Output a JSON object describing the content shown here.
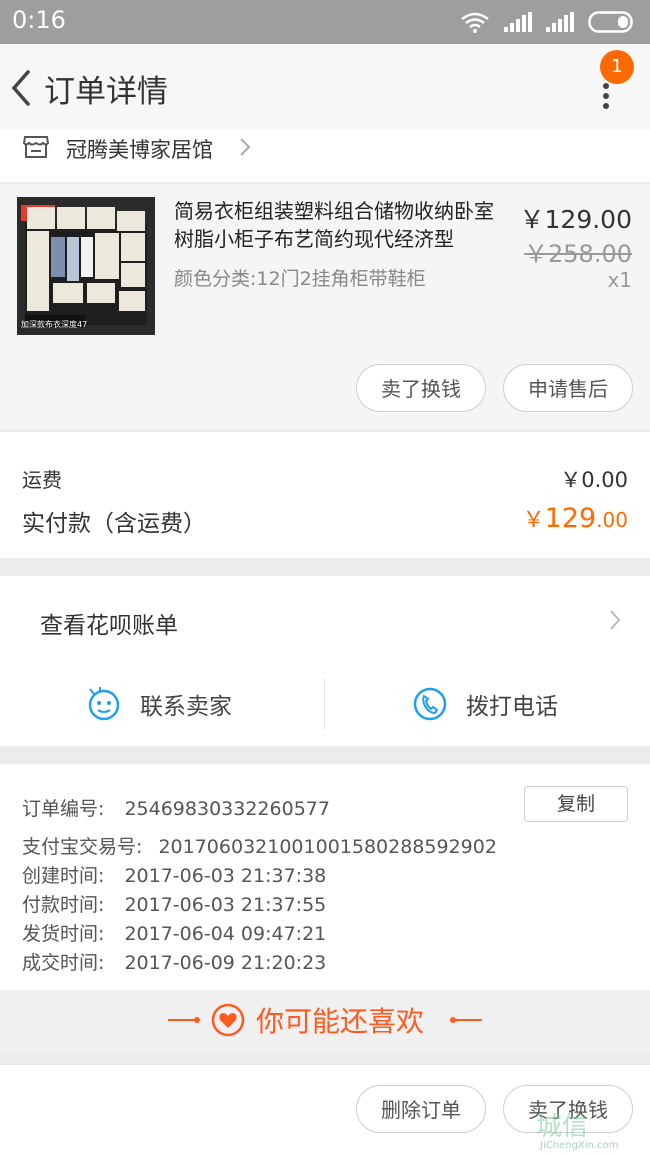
{
  "status_bar": {
    "time": "0:16"
  },
  "nav": {
    "title": "订单详情",
    "badge": "1"
  },
  "store": {
    "name": "冠腾美博家居馆"
  },
  "product": {
    "title": "简易衣柜组装塑料组合储物收纳卧室树脂小柜子布艺简约现代经济型",
    "spec": "颜色分类:12门2挂角柜带鞋柜",
    "price": "￥129.00",
    "original_price": "￥258.00",
    "quantity": "x1",
    "thumb_label": "冠腾",
    "thumb_caption": "加深款布衣深度47",
    "buttons": {
      "sell": "卖了换钱",
      "after_sale": "申请售后"
    }
  },
  "fees": {
    "shipping_label": "运费",
    "shipping_value": "￥0.00",
    "paid_label": "实付款（含运费）",
    "paid_currency": "￥",
    "paid_main": "129",
    "paid_cents": ".00"
  },
  "help": {
    "huabei_label": "查看花呗账单",
    "contact_seller": "联系卖家",
    "call_phone": "拨打电话"
  },
  "order_info": {
    "copy_label": "复制",
    "rows": [
      {
        "label": "订单编号:",
        "value": "25469830332260577"
      },
      {
        "label": "支付宝交易号:",
        "value": "2017060321001001580288592902"
      },
      {
        "label": "创建时间:",
        "value": "2017-06-03 21:37:38"
      },
      {
        "label": "付款时间:",
        "value": "2017-06-03 21:37:55"
      },
      {
        "label": "发货时间:",
        "value": "2017-06-04 09:47:21"
      },
      {
        "label": "成交时间:",
        "value": "2017-06-09 21:20:23"
      }
    ]
  },
  "recommend": {
    "title": "你可能还喜欢"
  },
  "bottom_bar": {
    "delete_order": "删除订单",
    "sell": "卖了换钱"
  },
  "watermark": {
    "text": "城信",
    "subtext": "JiChengXin.com"
  },
  "colors": {
    "accent": "#ff6a00",
    "icon_blue": "#1fa0e8"
  }
}
